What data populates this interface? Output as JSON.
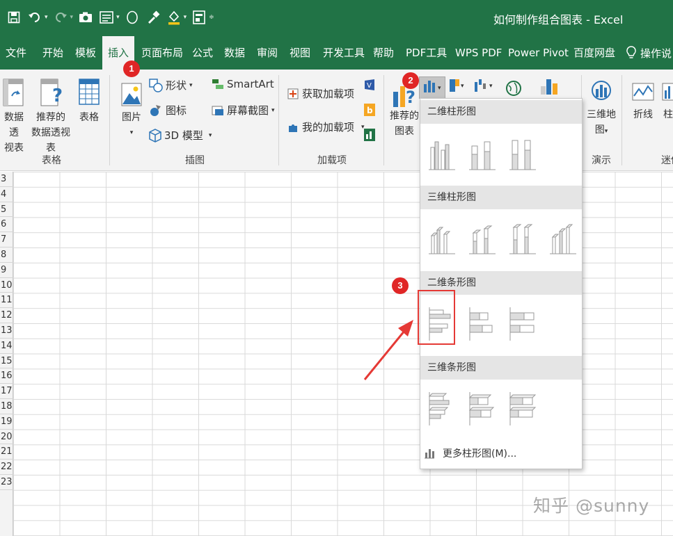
{
  "window": {
    "title": "如何制作组合图表 - Excel"
  },
  "tabs": [
    "文件",
    "开始",
    "模板",
    "插入",
    "页面布局",
    "公式",
    "数据",
    "审阅",
    "视图",
    "开发工具",
    "帮助",
    "PDF工具",
    "WPS PDF",
    "Power Pivot",
    "百度网盘"
  ],
  "tell_me": "操作说",
  "ribbon": {
    "pivot_table_line1": "数据透",
    "pivot_table_line2": "视表",
    "recommended_pivot_line1": "推荐的",
    "recommended_pivot_line2": "数据透视表",
    "table": "表格",
    "group_tables": "表格",
    "picture": "图片",
    "shapes": "形状",
    "icons": "图标",
    "model_3d": "3D 模型",
    "smartart": "SmartArt",
    "screenshot": "屏幕截图",
    "group_illustrations": "插图",
    "get_addins": "获取加载项",
    "my_addins": "我的加载项",
    "group_addins": "加载项",
    "recommended_charts_line1": "推荐的",
    "recommended_charts_line2": "图表",
    "map_3d_line1": "三维地",
    "map_3d_line2": "图",
    "group_tours": "演示",
    "sparkline_line": "折线",
    "sparkline_column": "柱",
    "group_sparklines": "迷你"
  },
  "badges": [
    "1",
    "2",
    "3"
  ],
  "rows": [
    "3",
    "4",
    "5",
    "6",
    "7",
    "8",
    "9",
    "10",
    "11",
    "12",
    "13",
    "14",
    "15",
    "16",
    "17",
    "18",
    "19",
    "20",
    "21",
    "22",
    "23"
  ],
  "dropdown": {
    "sections": [
      "二维柱形图",
      "三维柱形图",
      "二维条形图",
      "三维条形图"
    ],
    "more": "更多柱形图(M)..."
  },
  "watermark": "知乎 @sunny",
  "colors": {
    "excel_green": "#217346",
    "badge_red": "#e02626",
    "highlight_red": "#e53935"
  }
}
